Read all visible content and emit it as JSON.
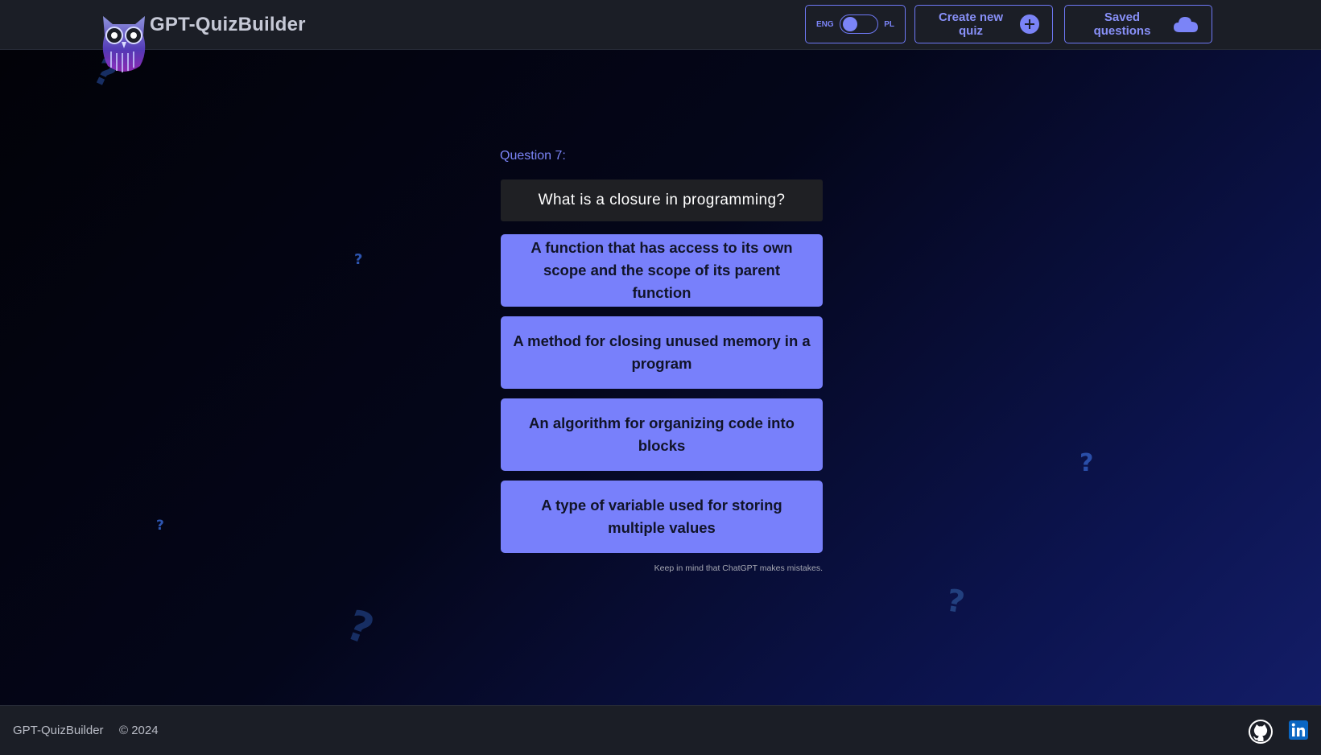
{
  "header": {
    "app_title": "GPT-QuizBuilder",
    "language_toggle": {
      "left_label": "ENG",
      "right_label": "PL",
      "selected": "ENG"
    },
    "create_quiz_label": "Create new quiz",
    "saved_questions_label": "Saved questions",
    "icons": {
      "logo": "owl-logo-icon",
      "create": "plus-circle-icon",
      "saved": "cloud-icon"
    }
  },
  "quiz": {
    "question_number": "Question 7:",
    "question_text": "What is a closure in programming?",
    "answers": [
      "A function that has access to its own scope and the scope of its parent function",
      "A method for closing unused memory in a program",
      "An algorithm for organizing code into blocks",
      "A type of variable used for storing multiple values"
    ],
    "disclaimer": "Keep in mind that ChatGPT makes mistakes."
  },
  "decorations": {
    "question_mark_glyph": "?"
  },
  "footer": {
    "brand": "GPT-QuizBuilder",
    "copyright": "© 2024",
    "icons": [
      "github-icon",
      "linkedin-icon"
    ]
  },
  "colors": {
    "accent": "#7880fb",
    "header_bg": "#1b1e26",
    "question_box_bg": "#1f2024"
  }
}
